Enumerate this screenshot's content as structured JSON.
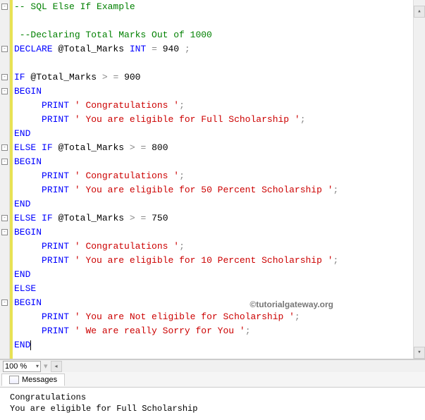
{
  "code": {
    "lines": [
      {
        "t": "comment",
        "text": "-- SQL Else If Example"
      },
      {
        "t": "blank",
        "text": ""
      },
      {
        "t": "comment",
        "text": " --Declaring Total Marks Out of 1000"
      },
      {
        "t": "declare",
        "kw": "DECLARE",
        "var": "@Total_Marks",
        "type": "INT",
        "eq": "=",
        "val": "940",
        "end": ";"
      },
      {
        "t": "blank",
        "text": ""
      },
      {
        "t": "if",
        "kw": "IF",
        "var": "@Total_Marks",
        "op": "> =",
        "val": "900"
      },
      {
        "t": "kw",
        "text": "BEGIN"
      },
      {
        "t": "print",
        "kw": "PRINT",
        "str": "' Congratulations '",
        "end": ";"
      },
      {
        "t": "print",
        "kw": "PRINT",
        "str": "' You are eligible for Full Scholarship '",
        "end": ";"
      },
      {
        "t": "kw",
        "text": "END"
      },
      {
        "t": "elseif",
        "kw1": "ELSE",
        "kw2": "IF",
        "var": "@Total_Marks",
        "op": "> =",
        "val": "800"
      },
      {
        "t": "kw",
        "text": "BEGIN"
      },
      {
        "t": "print",
        "kw": "PRINT",
        "str": "' Congratulations '",
        "end": ";"
      },
      {
        "t": "print",
        "kw": "PRINT",
        "str": "' You are eligible for 50 Percent Scholarship '",
        "end": ";"
      },
      {
        "t": "kw",
        "text": "END"
      },
      {
        "t": "elseif",
        "kw1": "ELSE",
        "kw2": "IF",
        "var": "@Total_Marks",
        "op": "> =",
        "val": "750"
      },
      {
        "t": "kw",
        "text": "BEGIN"
      },
      {
        "t": "print",
        "kw": "PRINT",
        "str": "' Congratulations '",
        "end": ";"
      },
      {
        "t": "print",
        "kw": "PRINT",
        "str": "' You are eligible for 10 Percent Scholarship '",
        "end": ";"
      },
      {
        "t": "kw",
        "text": "END"
      },
      {
        "t": "kw",
        "text": "ELSE"
      },
      {
        "t": "kw",
        "text": "BEGIN"
      },
      {
        "t": "print",
        "kw": "PRINT",
        "str": "' You are Not eligible for Scholarship '",
        "end": ";"
      },
      {
        "t": "print",
        "kw": "PRINT",
        "str": "' We are really Sorry for You '",
        "end": ";"
      },
      {
        "t": "kw-cursor",
        "text": "END"
      }
    ],
    "fold_lines": [
      0,
      3,
      5,
      6,
      10,
      11,
      15,
      16,
      21
    ]
  },
  "zoom": {
    "value": "100 %"
  },
  "watermark": "©tutorialgateway.org",
  "tab": {
    "label": "Messages"
  },
  "messages": [
    "Congratulations",
    "You are eligible for Full Scholarship"
  ]
}
